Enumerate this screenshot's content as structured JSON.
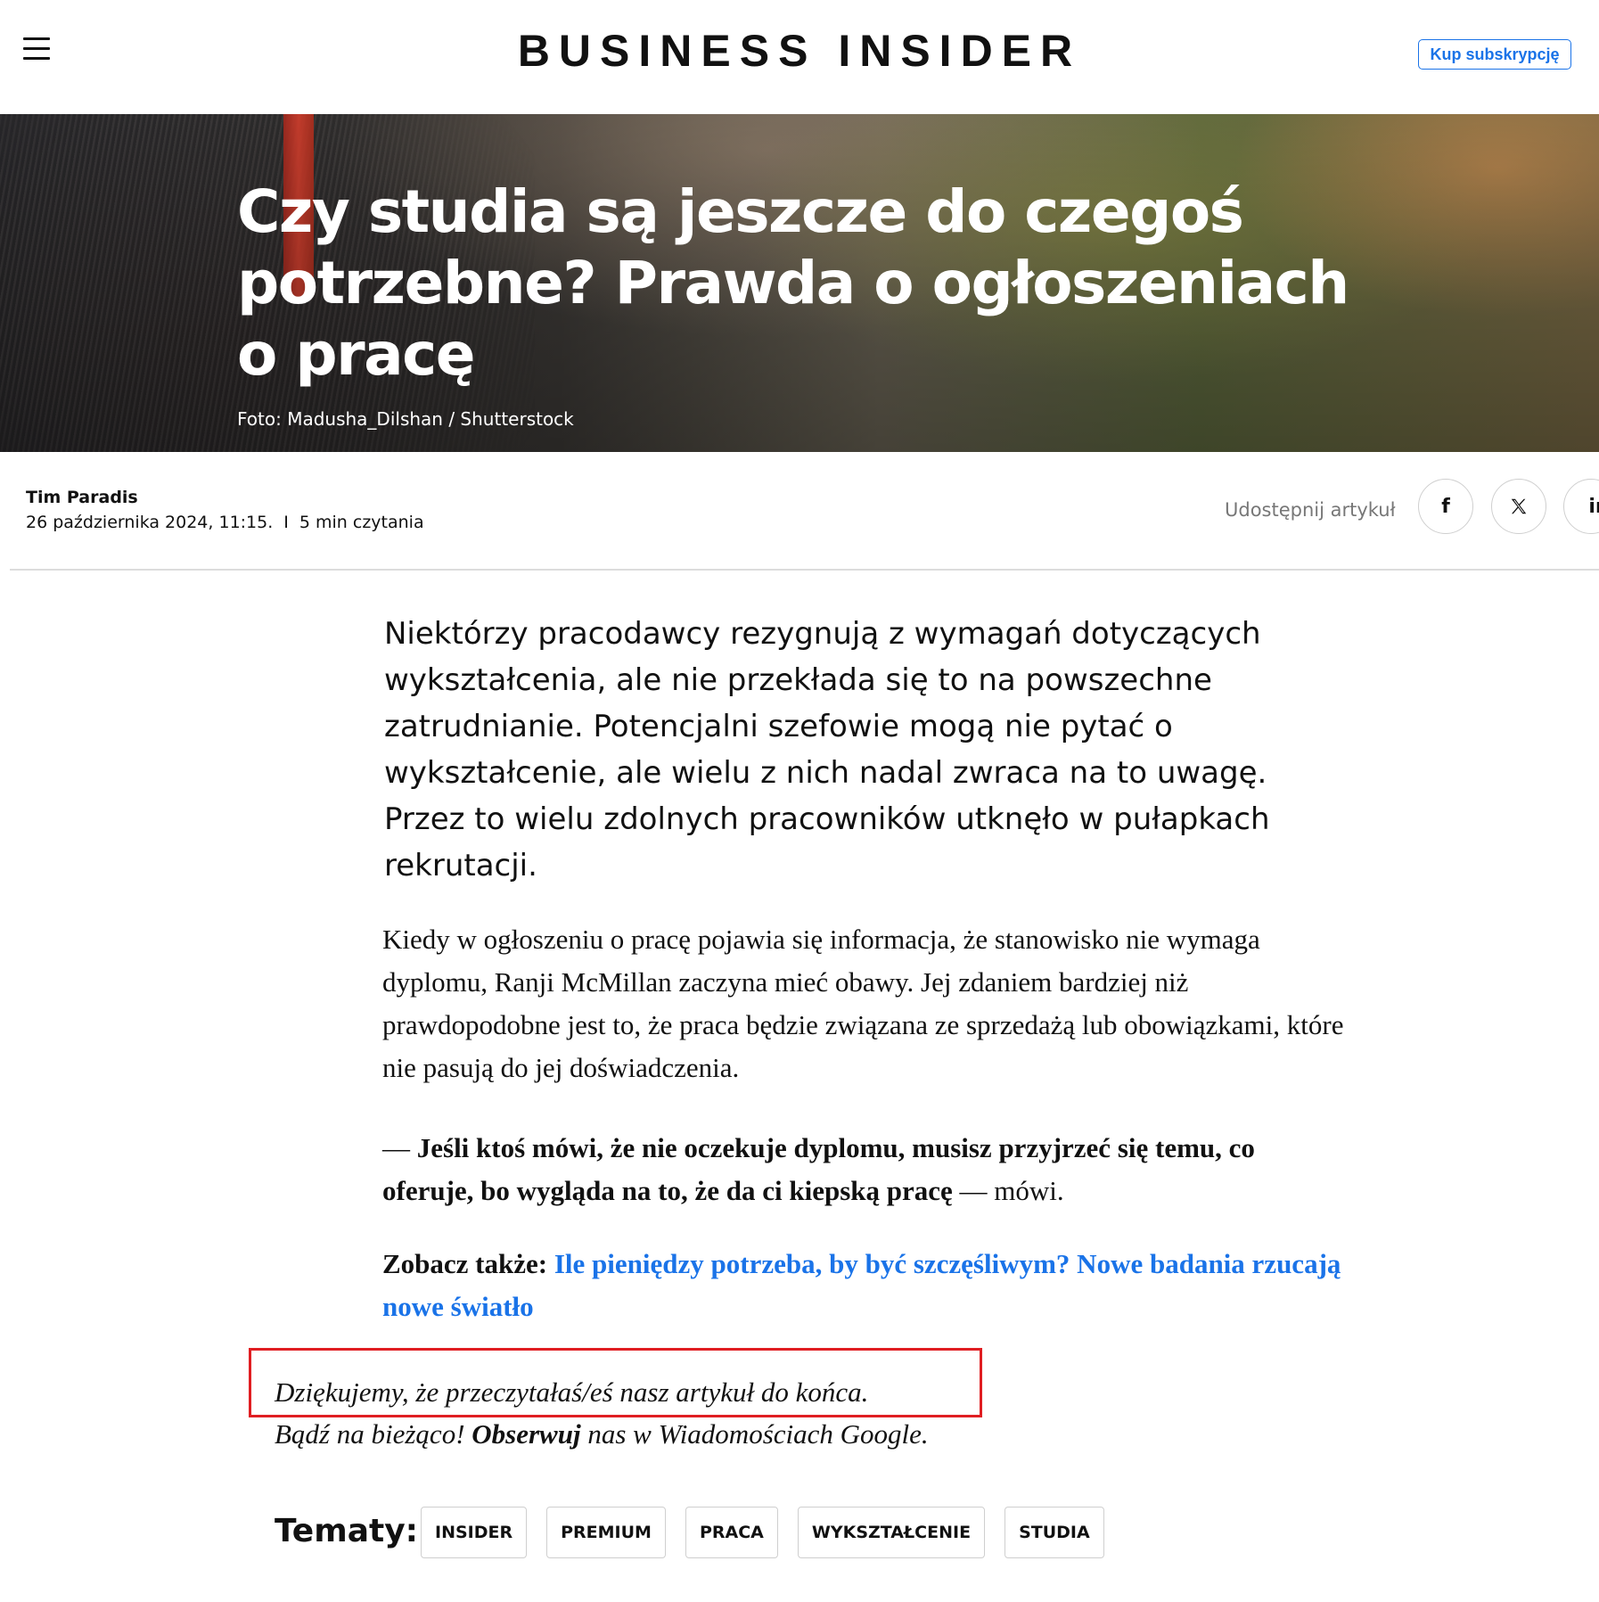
{
  "header": {
    "logo": "BUSINESS INSIDER",
    "subscribe_label": "Kup subskrypcję",
    "menu_icon": "hamburger-menu-icon"
  },
  "hero": {
    "headline": "Czy studia są jeszcze do czegoś potrzebne? Prawda o ogłoszeniach o pracę",
    "photo_credit": "Foto: Madusha_Dilshan / Shutterstock"
  },
  "meta": {
    "author": "Tim Paradis",
    "date": "26 października 2024, 11:15.",
    "separator": "I",
    "reading_time": "5 min czytania",
    "share_label": "Udostępnij artykuł",
    "share_icons": [
      "facebook-icon",
      "x-icon",
      "linkedin-icon"
    ]
  },
  "article": {
    "lead": "Niektórzy pracodawcy rezygnują z wymagań dotyczących wykształcenia, ale nie przekłada się to na powszechne zatrudnianie. Potencjalni szefowie mogą nie pytać o wykształcenie, ale wielu z nich nadal zwraca na to uwagę. Przez to wielu zdolnych pracowników utknęło w pułapkach rekrutacji.",
    "paragraph1": "Kiedy w ogłoszeniu o pracę pojawia się informacja, że stanowisko nie wymaga dyplomu, Ranji McMillan zaczyna mieć obawy. Jej zdaniem bardziej niż prawdopodobne jest to, że praca będzie związana ze sprzedażą lub obowiązkami, które nie pasują do jej doświadczenia.",
    "quote_dash": "— ",
    "quote_bold": "Jeśli ktoś mówi, że nie oczekuje dyplomu, musisz przyjrzeć się temu, co oferuje, bo wygląda na to, że da ci kiepską pracę",
    "quote_tail": " — mówi.",
    "see_also_label": "Zobacz także: ",
    "see_also_link": "Ile pieniędzy potrzeba, by być szczęśliwym? Nowe badania rzucają nowe światło",
    "thanks_line": "Dziękujemy, że przeczytałaś/eś nasz artykuł do końca.",
    "follow_pre": "Bądź na bieżąco! ",
    "follow_bold": "Obserwuj",
    "follow_post": " nas w Wiadomościach Google."
  },
  "topics": {
    "label": "Tematy:",
    "tags": [
      "INSIDER",
      "PREMIUM",
      "PRACA",
      "WYKSZTAŁCENIE",
      "STUDIA"
    ]
  },
  "colors": {
    "accent": "#1a73e8",
    "highlight": "#e01e22"
  }
}
